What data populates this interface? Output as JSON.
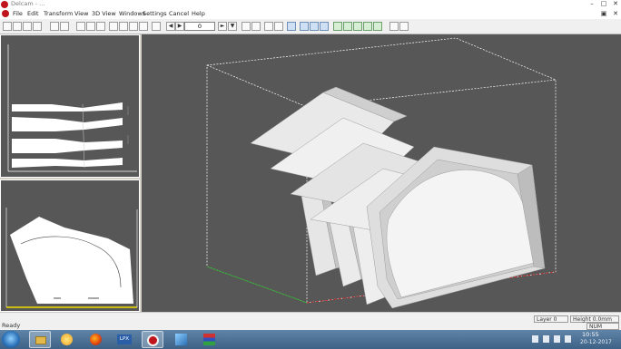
{
  "window": {
    "title": "Delcam - ...",
    "min_label": "–",
    "max_label": "□",
    "close_label": "✕"
  },
  "menu": [
    {
      "label": "File",
      "icon": "file-menu"
    },
    {
      "label": "Edit",
      "icon": "edit-menu"
    },
    {
      "label": "Transform",
      "icon": "transform-menu"
    },
    {
      "label": "View",
      "icon": "view-menu"
    },
    {
      "label": "3D View",
      "icon": "3d-view-menu"
    },
    {
      "label": "Windows",
      "icon": "windows-menu"
    },
    {
      "label": "Settings",
      "icon": "settings-menu"
    },
    {
      "label": "Cancel",
      "icon": "cancel-menu"
    },
    {
      "label": "Help",
      "icon": "help-menu"
    }
  ],
  "toolbar": {
    "frame_value": "0",
    "buttons": [
      "new-icon",
      "open-icon",
      "save-icon",
      "print-icon",
      "print-preview-icon",
      "cut-icon",
      "copy-icon",
      "paste-icon",
      "undo-icon",
      "redo-icon",
      "select-icon",
      "move-icon",
      "rotate-icon",
      "scale-icon",
      "prev-frame-icon",
      "next-frame-icon",
      "play-icon",
      "stop-icon",
      "zoom-in-icon",
      "zoom-out-icon",
      "zoom-fit-icon",
      "pan-icon",
      "orbit-icon",
      "view-front-icon",
      "view-top-icon",
      "view-side-icon",
      "view-iso-icon",
      "grid-icon",
      "render-icon",
      "settings-icon"
    ]
  },
  "status": {
    "text": "Ready",
    "layer": "Layer 0",
    "height": "Height 0.0mm",
    "mode": "NUM"
  },
  "taskbar": {
    "time": "10:55",
    "date": "20-12-2017",
    "apps": [
      "windows-explorer",
      "browser-ie",
      "firefox",
      "delcam",
      "lpx-app",
      "3d-app",
      "color-app",
      "winrar"
    ],
    "lpx_label": "LPX"
  },
  "colors": {
    "viewport_bg": "#575757",
    "accent_red": "#c0141c",
    "axis_green": "#2ea82e",
    "axis_red": "#d02020",
    "axis_yellow": "#f0e000"
  }
}
